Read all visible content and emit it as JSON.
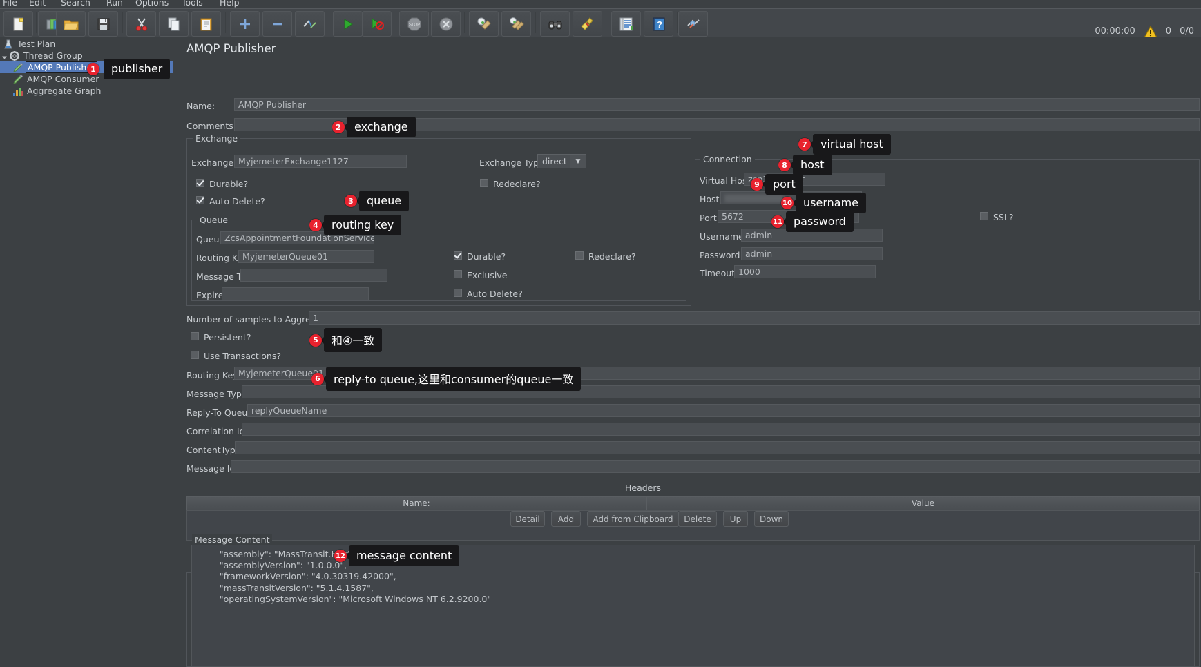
{
  "menubar": [
    "File",
    "Edit",
    "Search",
    "Run",
    "Options",
    "Tools",
    "Help"
  ],
  "toolbar": {
    "buttons": [
      {
        "name": "new-icon",
        "label": "New"
      },
      {
        "name": "templates-icon",
        "label": "Templates"
      },
      {
        "name": "open-icon",
        "label": "Open"
      },
      {
        "name": "save-icon",
        "label": "Save"
      },
      {
        "name": "cut-icon",
        "label": "Cut"
      },
      {
        "name": "copy-icon",
        "label": "Copy"
      },
      {
        "name": "paste-icon",
        "label": "Paste"
      },
      {
        "name": "expand-all-icon",
        "label": "Expand All"
      },
      {
        "name": "collapse-all-icon",
        "label": "Collapse All"
      },
      {
        "name": "toggle-icon",
        "label": "Toggle"
      },
      {
        "name": "start-icon",
        "label": "Start"
      },
      {
        "name": "start-no-pauses-icon",
        "label": "Start no pauses"
      },
      {
        "name": "stop-icon",
        "label": "Stop"
      },
      {
        "name": "shutdown-icon",
        "label": "Shutdown"
      },
      {
        "name": "clear-icon",
        "label": "Clear"
      },
      {
        "name": "clear-all-icon",
        "label": "Clear All"
      },
      {
        "name": "search-icon",
        "label": "Search"
      },
      {
        "name": "reset-search-icon",
        "label": "Reset Search"
      },
      {
        "name": "function-helper-icon",
        "label": "Function Helper Dialog"
      },
      {
        "name": "help-icon",
        "label": "Help"
      },
      {
        "name": "undo-icon",
        "label": "Undo"
      }
    ],
    "status": {
      "timer": "00:00:00",
      "warnings": "0",
      "threads": "0/0"
    }
  },
  "tree": {
    "items": [
      {
        "label": "Test Plan",
        "icon": "test-plan-icon",
        "indent": 0,
        "selected": false,
        "expander": ""
      },
      {
        "label": "Thread Group",
        "icon": "thread-group-icon",
        "indent": 0,
        "selected": false,
        "expander": "down"
      },
      {
        "label": "AMQP Publisher",
        "icon": "sampler-icon",
        "indent": 1,
        "selected": true,
        "expander": ""
      },
      {
        "label": "AMQP Consumer",
        "icon": "sampler-icon",
        "indent": 1,
        "selected": false,
        "expander": ""
      },
      {
        "label": "Aggregate Graph",
        "icon": "listener-icon",
        "indent": 1,
        "selected": false,
        "expander": ""
      }
    ]
  },
  "panel": {
    "title": "AMQP Publisher",
    "name_label": "Name:",
    "name_value": "AMQP Publisher",
    "comments_label": "Comments:",
    "comments_value": ""
  },
  "exchange_group": {
    "legend": "Exchange",
    "exchange_label": "Exchange",
    "exchange_value": "MyjemeterExchange1127",
    "type_label": "Exchange Type",
    "type_value": "direct",
    "durable_label": "Durable?",
    "durable_checked": true,
    "redeclare_label": "Redeclare?",
    "redeclare_checked": false,
    "auto_delete_label": "Auto Delete?",
    "auto_delete_checked": true
  },
  "queue_group": {
    "legend": "Queue",
    "queue_label": "Queue",
    "queue_value": "ZcsAppointmentFoundationService",
    "routing_key_label": "Routing Key",
    "routing_key_value": "MyjemeterQueue01",
    "ttl_label": "Message TTL",
    "ttl_value": "",
    "expires_label": "Expires",
    "expires_value": "",
    "durable_label": "Durable?",
    "durable_checked": true,
    "redeclare_label": "Redeclare?",
    "redeclare_checked": false,
    "exclusive_label": "Exclusive",
    "exclusive_checked": false,
    "auto_delete_label": "Auto Delete?",
    "auto_delete_checked": false
  },
  "connection_group": {
    "legend": "Connection",
    "virtual_host_label": "Virtual Host",
    "virtual_host_value": "zcp30current",
    "host_label": "Host",
    "host_value": "47.3...",
    "port_label": "Port",
    "port_value": "5672",
    "username_label": "Username",
    "username_value": "admin",
    "password_label": "Password",
    "password_value": "admin",
    "timeout_label": "Timeout",
    "timeout_value": "1000",
    "ssl_label": "SSL?",
    "ssl_checked": false
  },
  "message": {
    "aggregate_label": "Number of samples to Aggregate",
    "aggregate_value": "1",
    "persistent_label": "Persistent?",
    "persistent_checked": false,
    "transactions_label": "Use Transactions?",
    "transactions_checked": false,
    "routing_key_label": "Routing Key",
    "routing_key_value": "MyjemeterQueue01",
    "message_type_label": "Message Type",
    "message_type_value": "",
    "reply_to_label": "Reply-To Queue",
    "reply_to_value": "replyQueueName",
    "correlation_label": "Correlation Id",
    "correlation_value": "",
    "content_type_label": "ContentType",
    "content_type_value": "",
    "message_id_label": "Message Id",
    "message_id_value": ""
  },
  "headers": {
    "title": "Headers",
    "columns": [
      "Name:",
      "Value"
    ],
    "rows": [],
    "buttons": [
      "Detail",
      "Add",
      "Add from Clipboard",
      "Delete",
      "Up",
      "Down"
    ]
  },
  "message_content": {
    "label": "Message Content",
    "lines": [
      "    \"assembly\": \"MassTransit.Host\",",
      "    \"assemblyVersion\": \"1.0.0.0\",",
      "    \"frameworkVersion\": \"4.0.30319.42000\",",
      "    \"massTransitVersion\": \"5.1.4.1587\",",
      "    \"operatingSystemVersion\": \"Microsoft Windows NT 6.2.9200.0\""
    ]
  },
  "annotations": [
    {
      "n": "1",
      "text": "publisher"
    },
    {
      "n": "2",
      "text": "exchange"
    },
    {
      "n": "3",
      "text": "queue"
    },
    {
      "n": "4",
      "text": "routing key"
    },
    {
      "n": "5",
      "text": "和④一致"
    },
    {
      "n": "6",
      "text": "reply-to queue,这里和consumer的queue一致"
    },
    {
      "n": "7",
      "text": "virtual host"
    },
    {
      "n": "8",
      "text": "host"
    },
    {
      "n": "9",
      "text": "port"
    },
    {
      "n": "10",
      "text": "username"
    },
    {
      "n": "11",
      "text": "password"
    },
    {
      "n": "12",
      "text": "message content"
    }
  ],
  "colors": {
    "accent": "#e8222e",
    "selection": "#5479b8",
    "background": "#3c4043"
  }
}
